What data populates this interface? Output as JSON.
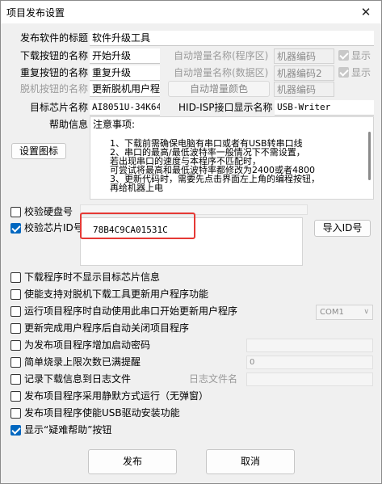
{
  "window": {
    "title": "项目发布设置",
    "close": "✕"
  },
  "fields": {
    "title_label": "发布软件的标题",
    "title_value": "软件升级工具",
    "download_label": "下载按钮的名称",
    "download_value": "开始升级",
    "retry_label": "重复按钮的名称",
    "retry_value": "重复升级",
    "offline_label": "脱机按钮的名称",
    "offline_value": "更新脱机用户程",
    "auto_inc_prog_label": "自动增量名称(程序区)",
    "auto_inc_prog_value": "机器编码",
    "show1_label": "显示",
    "auto_inc_data_label": "自动增量名称(数据区)",
    "auto_inc_data_value": "机器编码2",
    "show2_label": "显示",
    "auto_inc_color_label": "自动增量颜色",
    "machine_code_value": "机器编码",
    "chip_label": "目标芯片名称",
    "chip_value": "AI8051U-34K64",
    "hid_label": "HID-ISP接口显示名称",
    "hid_value": "USB-Writer",
    "help_label": "帮助信息",
    "set_icon_label": "设置图标"
  },
  "help": {
    "heading": "注意事项:",
    "lines": [
      "1、下载前需确保电脑有串口或者有USB转串口线",
      "2、串口的最高/最低波特率一般情况下不需设置，",
      "   若出现串口的速度与本程序不匹配时，",
      "   可尝试将最高和最低波特率都修改为2400或者4800",
      "3、更新代码时，需要先点击界面左上角的编程按钮，",
      "   再给机器上电"
    ]
  },
  "verify": {
    "disk_label": "校验硬盘号",
    "chip_id_label": "校验芯片ID号",
    "chip_id_value": "78B4C9CA01531C",
    "import_label": "导入ID号"
  },
  "options": [
    {
      "label": "下载程序时不显示目标芯片信息",
      "checked": false
    },
    {
      "label": "使能支持对脱机下载工具更新用户程序功能",
      "checked": false
    },
    {
      "label": "运行项目程序时自动使用此串口开始更新用户程序",
      "checked": false
    },
    {
      "label": "更新完成用户程序后自动关闭项目程序",
      "checked": false
    },
    {
      "label": "为发布项目程序增加启动密码",
      "checked": false
    },
    {
      "label": "简单烧录上限次数已满提醒",
      "checked": false
    },
    {
      "label": "记录下载信息到日志文件",
      "checked": false
    },
    {
      "label": "发布项目程序采用静默方式运行（无弹窗）",
      "checked": false
    },
    {
      "label": "发布项目程序使能USB驱动安装功能",
      "checked": false
    },
    {
      "label": "显示“疑难帮助”按钮",
      "checked": true
    }
  ],
  "serial": {
    "value": "COM1",
    "arrow": "∨"
  },
  "limit": {
    "value": "0"
  },
  "log": {
    "label": "日志文件名"
  },
  "buttons": {
    "publish": "发布",
    "cancel": "取消"
  }
}
